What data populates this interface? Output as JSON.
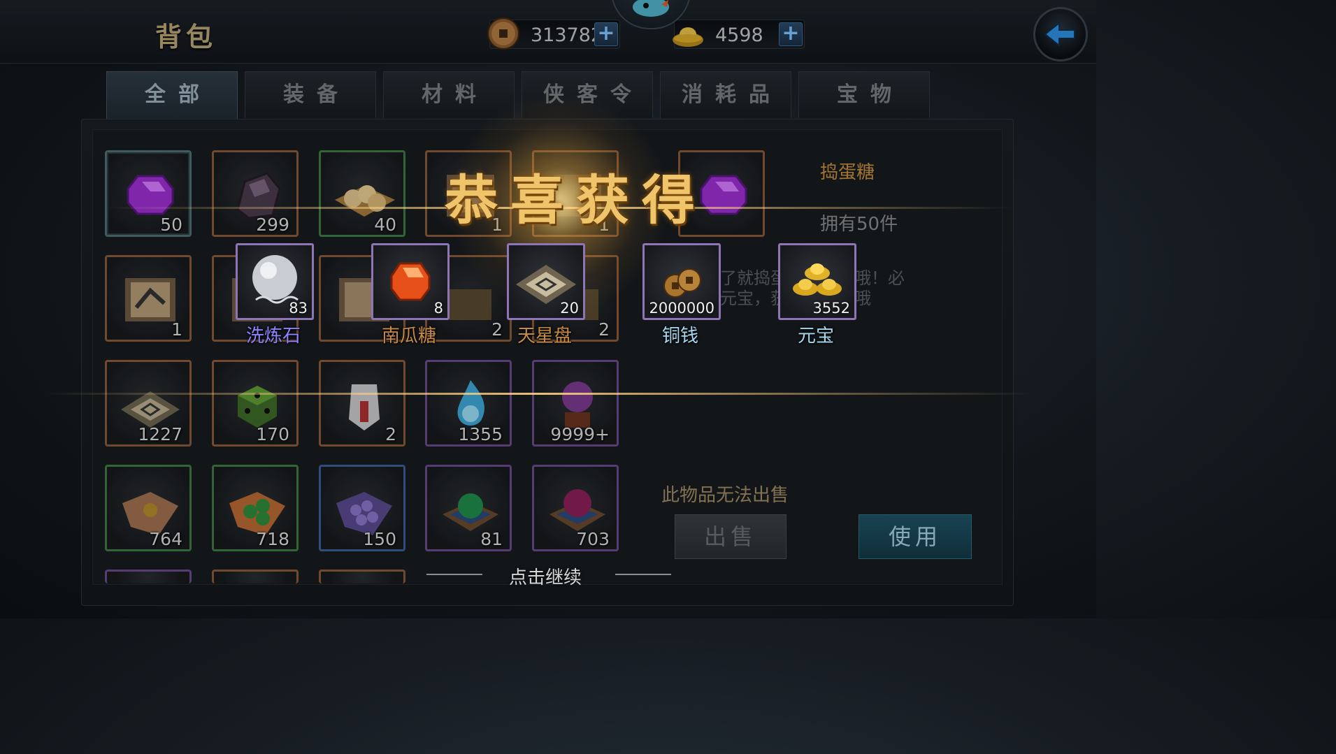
{
  "header": {
    "title": "背包",
    "copper": "3137823",
    "gold": "4598"
  },
  "tabs": [
    {
      "label": "全部",
      "active": true
    },
    {
      "label": "装备"
    },
    {
      "label": "材料"
    },
    {
      "label": "侠客令"
    },
    {
      "label": "消耗品"
    },
    {
      "label": "宝物"
    }
  ],
  "grid": {
    "row1": [
      "50",
      "299",
      "40",
      "1",
      "1"
    ],
    "row2": [
      "1",
      "2",
      "2"
    ],
    "row3": [
      "1227",
      "170",
      "2",
      "1355",
      "9999+"
    ],
    "row4": [
      "764",
      "718",
      "150",
      "81",
      "703"
    ]
  },
  "detail": {
    "name": "捣蛋糖",
    "owned": "拥有50件",
    "desc_line1": "吃了就捣蛋，有惊喜哦！必",
    "desc_line2": "得元宝，获得怪味糖哦",
    "no_sell": "此物品无法出售",
    "sell_label": "出售",
    "use_label": "使用"
  },
  "popup": {
    "title": "恭喜获得",
    "rewards": [
      {
        "name": "洗炼石",
        "count": "83",
        "color": "#8f82ff"
      },
      {
        "name": "南瓜糖",
        "count": "8",
        "color": "#c58a46"
      },
      {
        "name": "天星盘",
        "count": "20",
        "color": "#c58a46"
      },
      {
        "name": "铜钱",
        "count": "2000000",
        "color": "#a8d8f0"
      },
      {
        "name": "元宝",
        "count": "3552",
        "color": "#a8d8f0"
      }
    ],
    "continue": "点击继续"
  },
  "colors": {
    "accent_gold": "#f0c46b",
    "use_button": "#1f5263",
    "tab_active": "#2f3b46"
  }
}
